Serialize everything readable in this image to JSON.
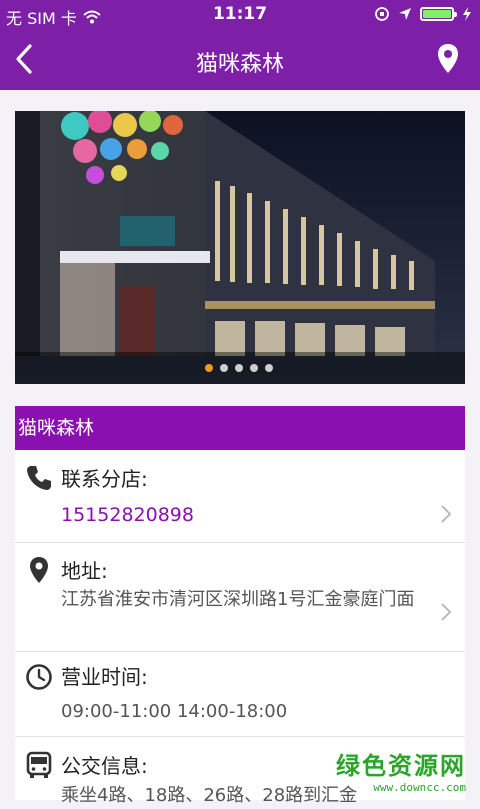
{
  "status_bar": {
    "carrier": "无 SIM 卡",
    "time": "11:17"
  },
  "nav": {
    "title": "猫咪森林",
    "back_icon": "chevron-left-icon",
    "location_icon": "location-pin-icon"
  },
  "banner": {
    "slides": 5,
    "active_slide": 1
  },
  "shop": {
    "name": "猫咪森林",
    "contact_label": "联系分店:",
    "phone": "15152820898",
    "address_label": "地址:",
    "address": "江苏省淮安市清河区深圳路1号汇金豪庭门面",
    "hours_label": "营业时间:",
    "hours": "09:00-11:00 14:00-18:00",
    "bus_label": "公交信息:",
    "bus": "乘坐4路、18路、26路、28路到汇金"
  },
  "watermark": {
    "text": "绿色资源网",
    "url": "www.downcc.com"
  },
  "colors": {
    "brand": "#7d1fa7",
    "accent": "#8a10b0",
    "phone": "#8a10b0"
  }
}
